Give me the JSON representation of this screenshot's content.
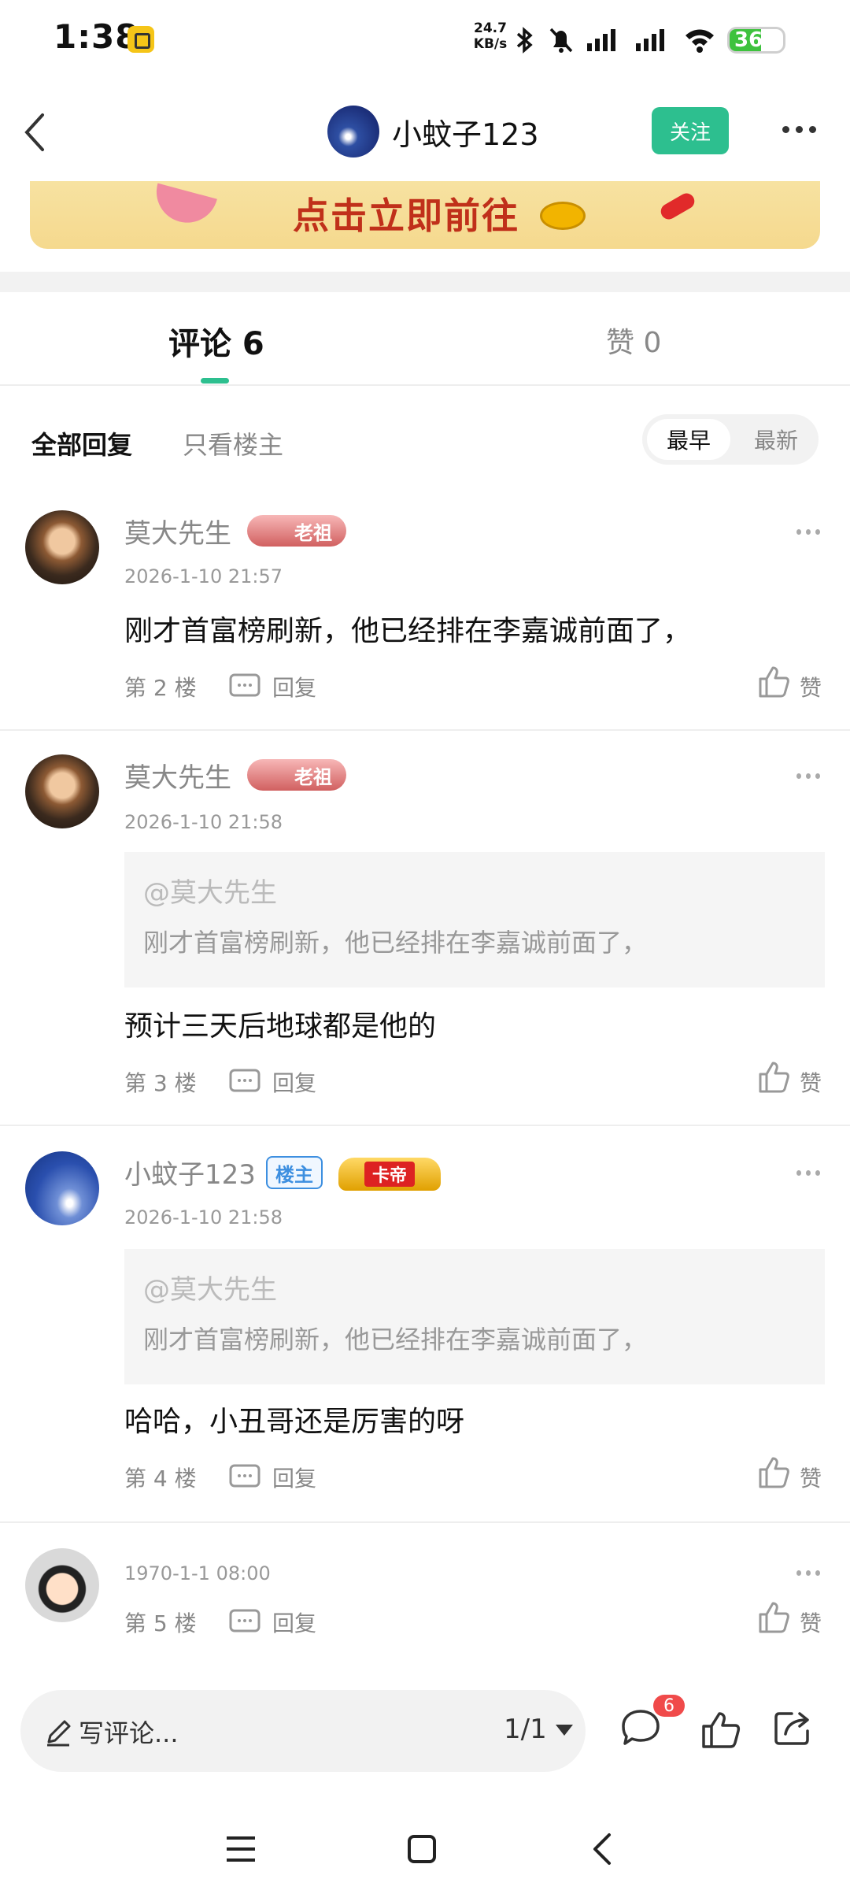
{
  "status_bar": {
    "time": "1:38",
    "net_speed_value": "24.7",
    "net_speed_unit": "KB/s",
    "battery": "36"
  },
  "header": {
    "author_name": "小蚊子123",
    "follow_label": "关注"
  },
  "banner": {
    "text": "点击立即前往"
  },
  "tabs": {
    "comments_label": "评论 6",
    "likes_label": "赞 0"
  },
  "filters": {
    "all_replies": "全部回复",
    "owner_only": "只看楼主",
    "sort_earliest": "最早",
    "sort_latest": "最新"
  },
  "comments": [
    {
      "name": "莫大先生",
      "badge": "老祖",
      "time": "2026-1-10 21:57",
      "text": "刚才首富榜刷新，他已经排在李嘉诚前面了，",
      "floor": "第 2 楼",
      "reply": "回复",
      "like": "赞"
    },
    {
      "name": "莫大先生",
      "badge": "老祖",
      "time": "2026-1-10 21:58",
      "quote_at": "@莫大先生",
      "quote_text": "刚才首富榜刷新，他已经排在李嘉诚前面了，",
      "text": "预计三天后地球都是他的",
      "floor": "第 3 楼",
      "reply": "回复",
      "like": "赞"
    },
    {
      "name": "小蚊子123",
      "badge_owner": "楼主",
      "badge": "卡帝",
      "time": "2026-1-10 21:58",
      "quote_at": "@莫大先生",
      "quote_text": "刚才首富榜刷新，他已经排在李嘉诚前面了，",
      "text": "哈哈，小丑哥还是厉害的呀",
      "floor": "第 4 楼",
      "reply": "回复",
      "like": "赞"
    },
    {
      "time": "1970-1-1 08:00",
      "floor": "第 5 楼",
      "reply": "回复",
      "like": "赞"
    }
  ],
  "bottom_bar": {
    "input_placeholder": "写评论...",
    "page": "1/1",
    "comment_count": "6"
  },
  "colors": {
    "accent": "#2dbf8f",
    "badge_red": "#f04a4a"
  }
}
